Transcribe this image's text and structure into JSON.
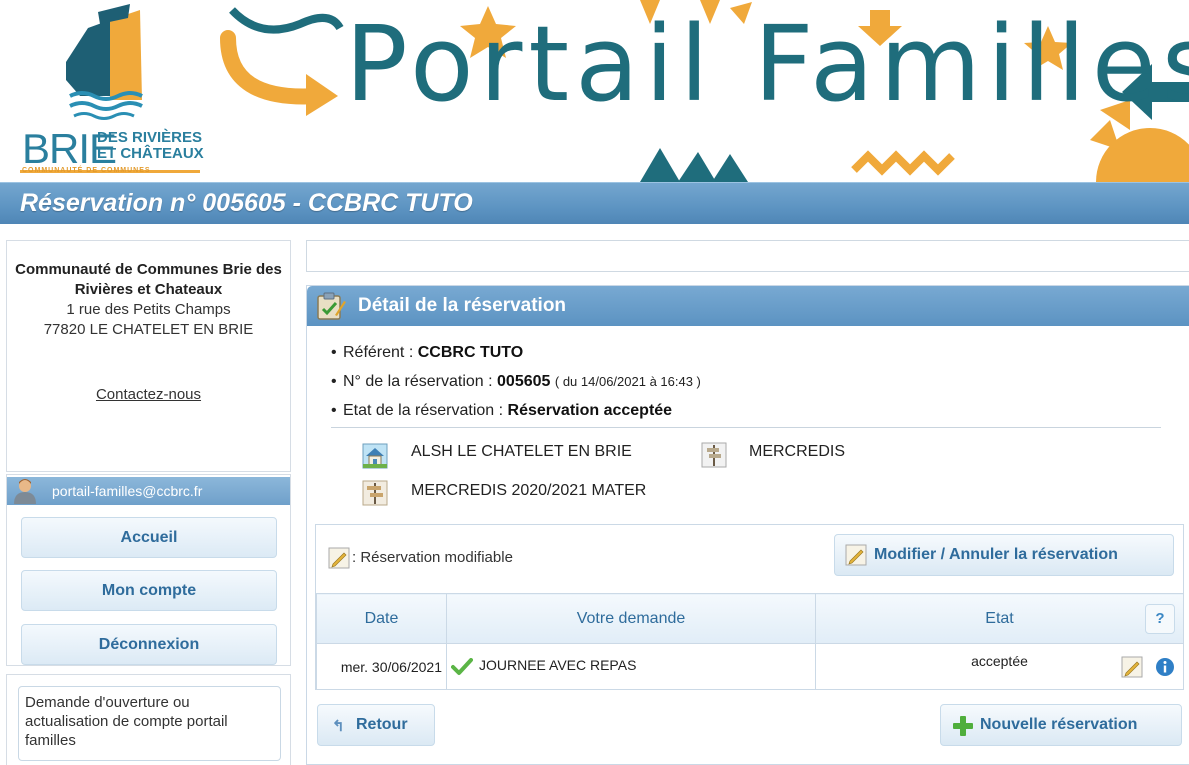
{
  "banner": {
    "brand_main": "BRIE",
    "brand_sub_1": "DES RIVIÈRES",
    "brand_sub_2": "ET CHÂTEAUX",
    "brand_tagline": "COMMUNAUTÉ DE COMMUNES",
    "title": "Portail Familles"
  },
  "page_title": "Réservation n° 005605 - CCBRC TUTO",
  "sidebar": {
    "org_name": "Communauté de Communes Brie des Rivières et Chateaux",
    "address_line1": "1 rue des Petits Champs",
    "address_line2": "77820 LE CHATELET EN BRIE",
    "contact_link": "Contactez-nous",
    "user_email": "portail-familles@ccbrc.fr",
    "menu": [
      "Accueil",
      "Mon compte",
      "Déconnexion"
    ],
    "request_link": "Demande d'ouverture ou actualisation de compte portail familles"
  },
  "detail": {
    "panel_title": "Détail de la réservation",
    "referent_label": "Référent :",
    "referent_value": "CCBRC TUTO",
    "number_label": "N° de la réservation :",
    "number_value": "005605",
    "number_date": "( du 14/06/2021 à 16:43 )",
    "state_label": "Etat de la réservation :",
    "state_value": "Réservation acceptée",
    "activity_site": "ALSH LE CHATELET EN BRIE",
    "activity_period": "MERCREDIS",
    "activity_group": "MERCREDIS 2020/2021 MATER",
    "legend_text": ": Réservation modifiable",
    "modify_button": "Modifier / Annuler la réservation",
    "table": {
      "headers": [
        "Date",
        "Votre demande",
        "Etat"
      ],
      "help_button": "?",
      "rows": [
        {
          "date": "mer. 30/06/2021",
          "request": "JOURNEE AVEC REPAS",
          "state": "acceptée"
        }
      ]
    },
    "back_button": "Retour",
    "new_button": "Nouvelle réservation"
  },
  "colors": {
    "title_bar": "#5d94c2",
    "accent_text": "#2f6c9c",
    "banner_teal": "#1f6d7c",
    "banner_orange": "#f0a93b"
  }
}
